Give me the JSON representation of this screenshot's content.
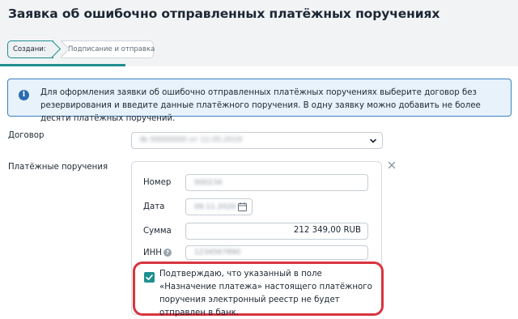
{
  "page": {
    "title": "Заявка об ошибочно отправленных платёжных поручениях"
  },
  "steps": [
    {
      "label": "Создание",
      "active": true
    },
    {
      "label": "Подписание и отправка",
      "active": false
    }
  ],
  "info": {
    "icon": "info-icon",
    "text": "Для оформления заявки об ошибочно отправленных платёжных поручениях выберите договор без резервирования и введите данные платёжного поручения. В одну заявку можно добавить не более десяти платёжных поручений."
  },
  "contract": {
    "label": "Договор",
    "value": "№ 00000000 от 12.05.2019"
  },
  "payments": {
    "label": "Платёжные поручения",
    "number_label": "Номер",
    "number_value": "000234",
    "date_label": "Дата",
    "date_value": "09.11.2020",
    "amount_label": "Сумма",
    "amount_value": "212 349,00  RUB",
    "inn_label": "ИНН",
    "inn_value": "1234567890",
    "confirm_text": "Подтверждаю, что указанный в поле «Назначение платежа» настоящего платёжного поручения электронный реестр не будет отправлен в банк.",
    "confirm_checked": true
  },
  "colors": {
    "accent": "#1f8f8f",
    "info_border": "#3c7fc0",
    "info_bg": "#e7f2fa",
    "highlight": "#d9343f"
  }
}
